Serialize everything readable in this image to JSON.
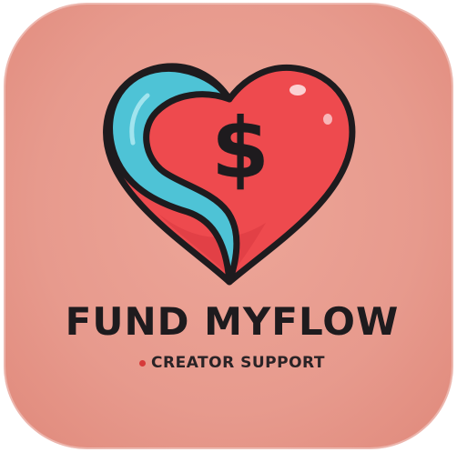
{
  "app_icon": {
    "brand_name": "FUND MYFLOW",
    "tagline": "CREATOR SUPPORT",
    "symbol": "$",
    "icons": [
      "heart-icon",
      "dollar-sign-icon",
      "flow-swoosh-icon"
    ],
    "colors": {
      "tile_background": "#e79a8d",
      "heart_red": "#ee4a4e",
      "swoosh_blue": "#4ec3d6",
      "outline": "#1e1b1e",
      "tagline_dot": "#d63a3a"
    }
  }
}
